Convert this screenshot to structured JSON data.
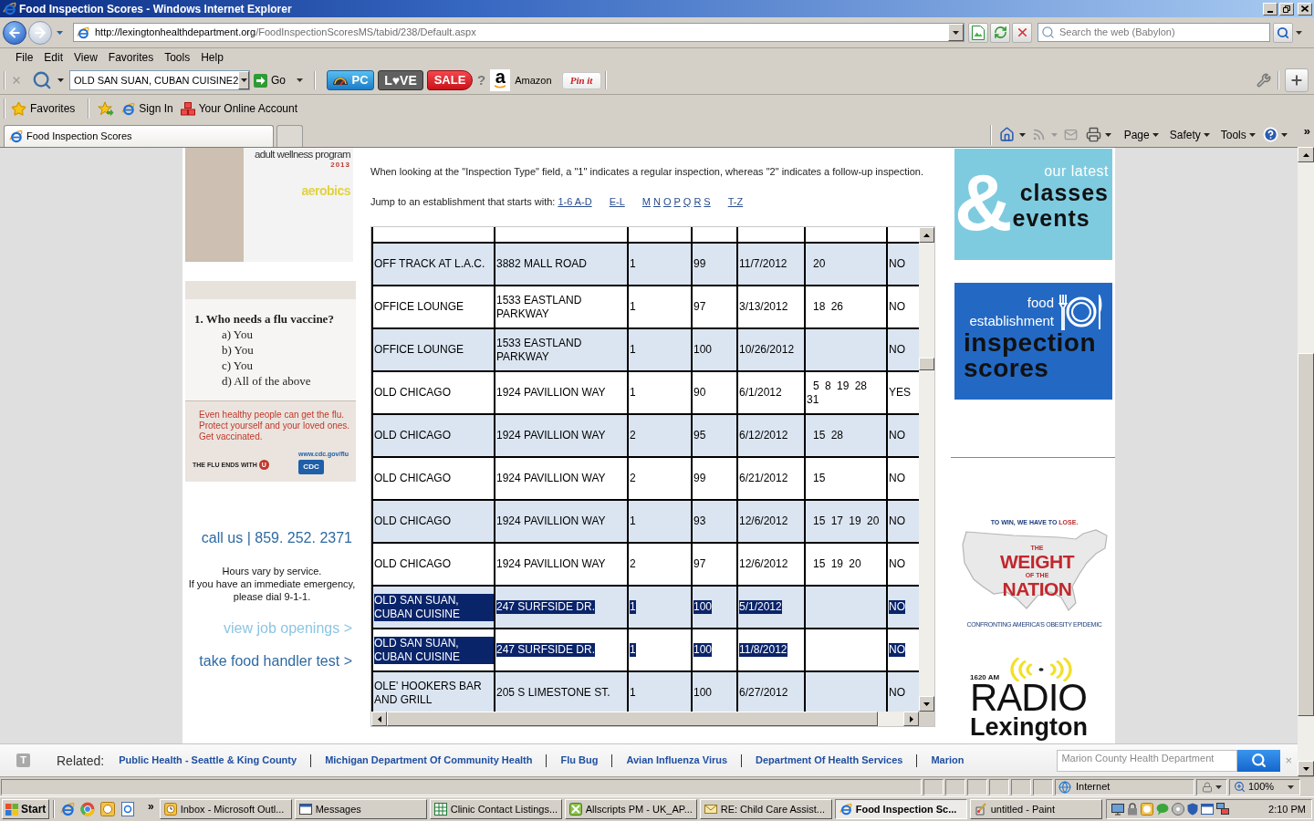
{
  "window": {
    "title": "Food Inspection Scores - Windows Internet Explorer"
  },
  "address_bar": {
    "url_domain": "http://lexingtonhealthdepartment.org",
    "url_path": "/FoodInspectionScoresMS/tabid/238/Default.aspx",
    "search_placeholder": "Search the web (Babylon)"
  },
  "menu": [
    "File",
    "Edit",
    "View",
    "Favorites",
    "Tools",
    "Help"
  ],
  "toolbar": {
    "search_value": "OLD SAN SUAN, CUBAN CUISINE2",
    "go": "Go",
    "badges": [
      {
        "kind": "gauge",
        "text": "PC"
      },
      {
        "kind": "heart",
        "text": "L♥VE"
      },
      {
        "kind": "tag",
        "text": "SALE"
      }
    ],
    "help_mark": "?",
    "amazon_logo": "a",
    "amazon": "Amazon",
    "pin": "Pin it"
  },
  "favorites_bar": {
    "favorites": "Favorites",
    "links": [
      {
        "kind": "browser",
        "label": "Sign In"
      },
      {
        "kind": "cubes",
        "label": "Your Online Account"
      }
    ]
  },
  "tabs": [
    {
      "label": "Food Inspection Scores",
      "selected": true
    }
  ],
  "command_bar": {
    "menus": [
      "Page",
      "Safety",
      "Tools"
    ],
    "overflow": "»"
  },
  "page": {
    "wellness_ad": {
      "title": "adult wellness program",
      "year": "2013",
      "tagline": "aerobics"
    },
    "flu_ad": {
      "question": "1. Who needs a flu vaccine?",
      "answers": [
        "a) You",
        "b) You",
        "c) You",
        "d) All of the above"
      ],
      "message": [
        "Even healthy people can get the flu.",
        "Protect yourself and your loved ones.",
        "Get vaccinated."
      ],
      "url": "www.cdc.gov/flu",
      "slogan": "THE FLU ENDS WITH",
      "slogan_mark": "U",
      "agency": "CDC"
    },
    "contact": {
      "phone": "call us | 859. 252. 2371",
      "hours": [
        "Hours vary by service.",
        "If you have an immediate emergency,",
        "please dial 9-1-1."
      ],
      "links": [
        {
          "kind": "light",
          "label": "view job openings >"
        },
        {
          "kind": "dark",
          "label": "take food handler test >"
        }
      ]
    },
    "note": "When looking at the \"Inspection Type\" field, a \"1\" indicates a regular inspection, whereas \"2\" indicates a follow-up inspection.",
    "jump": {
      "label": "Jump to an establishment that starts with:",
      "groups": [
        [
          "1-6 A-D"
        ],
        [
          "E-L"
        ],
        [
          "M",
          "N",
          "O",
          "P",
          "Q",
          "R",
          "S"
        ],
        [
          "T-Z"
        ]
      ]
    },
    "table": {
      "rows": [
        {
          "selected": false,
          "column_1": "OFF TRACK AT L.A.C.",
          "column_2": "3882 MALL ROAD",
          "column_3": "1",
          "column_4": "99",
          "column_5": "11/7/2012",
          "column_6": "20",
          "column_7": "NO"
        },
        {
          "selected": false,
          "column_1": "OFFICE LOUNGE",
          "column_2": "1533 EASTLAND PARKWAY",
          "column_3": "1",
          "column_4": "97",
          "column_5": "3/13/2012",
          "column_6": "18 26",
          "column_7": "NO"
        },
        {
          "selected": false,
          "column_1": "OFFICE LOUNGE",
          "column_2": "1533 EASTLAND PARKWAY",
          "column_3": "1",
          "column_4": "100",
          "column_5": "10/26/2012",
          "column_7": "NO"
        },
        {
          "selected": false,
          "column_1": "OLD CHICAGO",
          "column_2": "1924 PAVILLION WAY",
          "column_3": "1",
          "column_4": "90",
          "column_5": "6/1/2012",
          "column_6": "5 8 19 28 31",
          "column_7": "YES"
        },
        {
          "selected": false,
          "column_1": "OLD CHICAGO",
          "column_2": "1924 PAVILLION WAY",
          "column_3": "2",
          "column_4": "95",
          "column_5": "6/12/2012",
          "column_6": "15 28",
          "column_7": "NO"
        },
        {
          "selected": false,
          "column_1": "OLD CHICAGO",
          "column_2": "1924 PAVILLION WAY",
          "column_3": "2",
          "column_4": "99",
          "column_5": "6/21/2012",
          "column_6": "15",
          "column_7": "NO"
        },
        {
          "selected": false,
          "column_1": "OLD CHICAGO",
          "column_2": "1924 PAVILLION WAY",
          "column_3": "1",
          "column_4": "93",
          "column_5": "12/6/2012",
          "column_6": "15 17 19 20",
          "column_7": "NO"
        },
        {
          "selected": false,
          "column_1": "OLD CHICAGO",
          "column_2": "1924 PAVILLION WAY",
          "column_3": "2",
          "column_4": "97",
          "column_5": "12/6/2012",
          "column_6": "15 19 20",
          "column_7": "NO"
        },
        {
          "selected": true,
          "column_1": "OLD SAN SUAN, CUBAN CUISINE",
          "column_2": "247 SURFSIDE DR.",
          "column_3": "1",
          "column_4": "100",
          "column_5": "5/1/2012",
          "column_7": "NO"
        },
        {
          "selected": true,
          "column_1": "OLD SAN SUAN, CUBAN CUISINE",
          "column_2": "247 SURFSIDE DR.",
          "column_3": "1",
          "column_4": "100",
          "column_5": "11/8/2012",
          "column_7": "NO"
        },
        {
          "selected": false,
          "column_1": "OLE' HOOKERS BAR AND GRILL",
          "column_2": "205 S LIMESTONE ST.",
          "column_3": "1",
          "column_4": "100",
          "column_5": "6/27/2012",
          "column_7": "NO"
        }
      ]
    },
    "classes_ad": {
      "mark": "&",
      "kicker": "our latest",
      "lines": [
        "classes",
        "events"
      ]
    },
    "inspection_ad": {
      "kicker": [
        "food",
        "establishment"
      ],
      "lines": [
        "inspection",
        "scores"
      ]
    },
    "weight_ad": {
      "tagline": "TO WIN, WE HAVE TO",
      "tagline_accent": "LOSE.",
      "title": [
        {
          "kind": "small",
          "text": "THE"
        },
        {
          "kind": "large",
          "text": "WEIGHT"
        },
        {
          "kind": "small",
          "text": "OF THE"
        },
        {
          "kind": "large",
          "text": "NATION"
        }
      ],
      "caption": "CONFRONTING AMERICA'S OBESITY EPIDEMIC"
    },
    "radio_ad": {
      "frequency": "1620 AM",
      "name": "RADIO",
      "city": "Lexington"
    }
  },
  "related_bar": {
    "logo_mark": "T",
    "label": "Related:",
    "links": [
      "Public Health - Seattle & King County",
      "Michigan Department Of Community Health",
      "Flu Bug",
      "Avian Influenza Virus",
      "Department Of Health Services",
      "Marion"
    ],
    "search_placeholder": "Marion County Health Department",
    "close": "×"
  },
  "status_bar": {
    "zone": "Internet",
    "zoom": "100%"
  },
  "taskbar": {
    "start": "Start",
    "overflow": "»",
    "items": [
      {
        "kind": "calendar",
        "label": "Inbox - Microsoft Outl...",
        "selected": false
      },
      {
        "kind": "window",
        "label": "Messages",
        "selected": false
      },
      {
        "kind": "sheet",
        "label": "Clinic Contact Listings...",
        "selected": false
      },
      {
        "kind": "grid",
        "label": "Allscripts PM - UK_AP...",
        "selected": false
      },
      {
        "kind": "mail",
        "label": "RE: Child Care Assist...",
        "selected": false
      },
      {
        "kind": "browser",
        "label": "Food Inspection Sc...",
        "selected": true
      },
      {
        "kind": "paint",
        "label": "untitled - Paint",
        "selected": false
      }
    ],
    "clock": "2:10 PM"
  }
}
